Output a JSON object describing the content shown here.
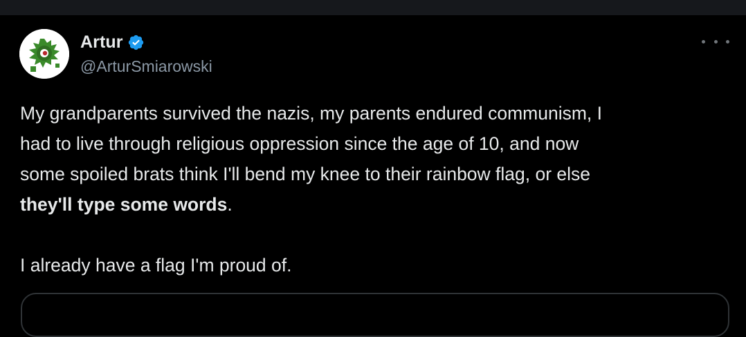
{
  "author": {
    "display_name": "Artur",
    "handle": "@ArturSmiarowski",
    "verified": true,
    "verified_color": "#1d9bf0"
  },
  "tweet": {
    "lines": [
      "My grandparents survived the nazis, my parents endured communism, I",
      "had to live through religious oppression since the age of 10, and now",
      "some spoiled brats think I'll bend my knee to their rainbow flag, or else"
    ],
    "bold_fragment": "they'll type some words",
    "after_bold": ".",
    "closing_line": "I already have a flag I'm proud of."
  },
  "icons": {
    "verified": "verified-badge-icon",
    "more": "more-options-icon"
  },
  "colors": {
    "background": "#000000",
    "text_primary": "#e7e9ea",
    "text_secondary": "#8b98a5",
    "avatar_green": "#3a8a2a"
  }
}
